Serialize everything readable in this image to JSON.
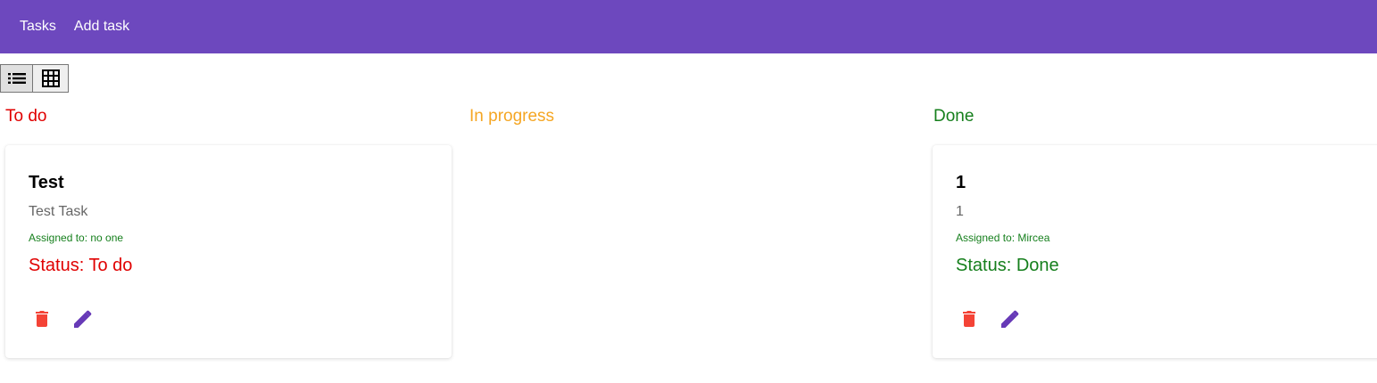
{
  "nav": {
    "tasks_label": "Tasks",
    "add_task_label": "Add task"
  },
  "view_toggle": {
    "list_icon": "list-icon",
    "grid_icon": "grid-icon"
  },
  "columns": [
    {
      "title": "To do",
      "color": "#e00000",
      "cards": [
        {
          "title": "Test",
          "description": "Test Task",
          "assigned": "Assigned to: no one",
          "status": "Status: To do",
          "status_color": "#e00000"
        }
      ]
    },
    {
      "title": "In progress",
      "color": "#f5a623",
      "cards": []
    },
    {
      "title": "Done",
      "color": "#157f1c",
      "cards": [
        {
          "title": "1",
          "description": "1",
          "assigned": "Assigned to: Mircea",
          "status": "Status: Done",
          "status_color": "#157f1c"
        }
      ]
    }
  ],
  "colors": {
    "brand": "#6d48be",
    "assigned_text": "#157f1c",
    "delete_icon": "#f44336",
    "edit_icon": "#673ab7"
  }
}
